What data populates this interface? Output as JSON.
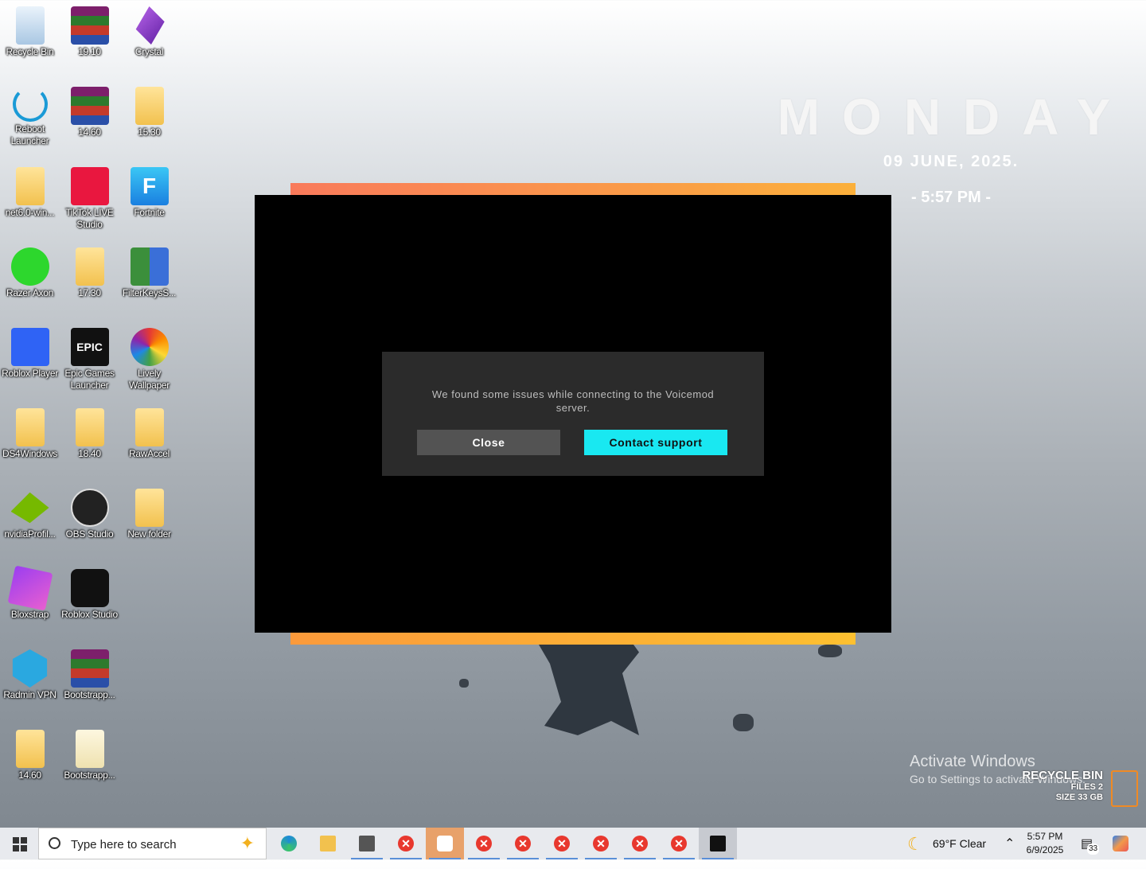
{
  "desktop": {
    "icons": [
      {
        "label": "Recycle Bin"
      },
      {
        "label": "19.10"
      },
      {
        "label": "Crystal"
      },
      {
        "label": "Reboot Launcher"
      },
      {
        "label": "14.60"
      },
      {
        "label": "15.30"
      },
      {
        "label": "net6.0-win..."
      },
      {
        "label": "TikTok LIVE Studio"
      },
      {
        "label": "Fortnite"
      },
      {
        "label": "Razer Axon"
      },
      {
        "label": "17.30"
      },
      {
        "label": "FilterKeysS..."
      },
      {
        "label": "Roblox Player"
      },
      {
        "label": "Epic Games Launcher"
      },
      {
        "label": "Lively Wallpaper"
      },
      {
        "label": "DS4Windows"
      },
      {
        "label": "18.40"
      },
      {
        "label": "RawAccel"
      },
      {
        "label": "nvidiaProfil..."
      },
      {
        "label": "OBS Studio"
      },
      {
        "label": "New folder"
      },
      {
        "label": "Bloxstrap"
      },
      {
        "label": "Roblox Studio"
      },
      {
        "label": "Radmin VPN"
      },
      {
        "label": "Bootstrapp..."
      },
      {
        "label": "14.60"
      },
      {
        "label": "Bootstrapp..."
      }
    ]
  },
  "widget": {
    "day": "MONDAY",
    "date": "09 JUNE, 2025.",
    "time": "- 5:57 PM -"
  },
  "dialog": {
    "message": "We found some issues while connecting to the Voicemod server.",
    "close_label": "Close",
    "support_label": "Contact support"
  },
  "watermark": {
    "activate_title": "Activate Windows",
    "activate_sub": "Go to Settings to activate Windows."
  },
  "recycle_widget": {
    "title": "RECYCLE BIN",
    "files": "FILES 2",
    "size": "SIZE 33 GB"
  },
  "taskbar": {
    "search_placeholder": "Type here to search",
    "weather": "69°F  Clear",
    "time": "5:57 PM",
    "date": "6/9/2025",
    "notification_count": "33"
  },
  "colors": {
    "accent_cyan": "#19e8f1",
    "frame_orange": "#f97a5b",
    "error_red": "#e8382e"
  }
}
